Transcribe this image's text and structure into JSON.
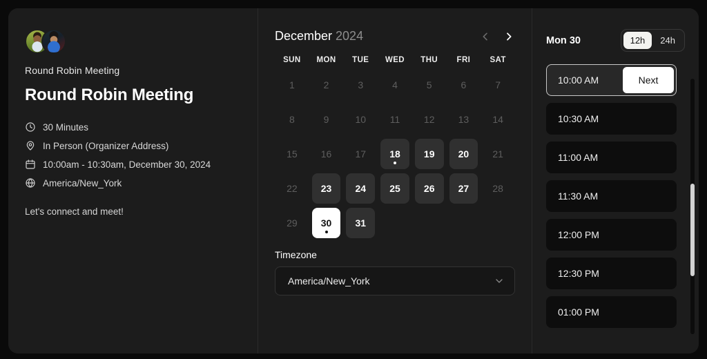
{
  "event": {
    "organizer_label": "Round Robin Meeting",
    "title": "Round Robin Meeting",
    "description": "Let's connect and meet!",
    "avatars": [
      {
        "name": "organizer-avatar-1"
      },
      {
        "name": "organizer-avatar-2"
      }
    ],
    "meta": [
      {
        "icon": "clock-icon",
        "text": "30 Minutes"
      },
      {
        "icon": "location-pin-icon",
        "text": "In Person (Organizer Address)"
      },
      {
        "icon": "calendar-icon",
        "text": "10:00am - 10:30am, December 30, 2024"
      },
      {
        "icon": "globe-icon",
        "text": "America/New_York"
      }
    ]
  },
  "calendar": {
    "month": "December",
    "year": "2024",
    "prev_label": "Previous month",
    "next_label": "Next month",
    "weekdays": [
      "SUN",
      "MON",
      "TUE",
      "WED",
      "THU",
      "FRI",
      "SAT"
    ],
    "leading_blanks": 0,
    "days": [
      {
        "n": "1",
        "state": "disabled"
      },
      {
        "n": "2",
        "state": "disabled"
      },
      {
        "n": "3",
        "state": "disabled"
      },
      {
        "n": "4",
        "state": "disabled"
      },
      {
        "n": "5",
        "state": "disabled"
      },
      {
        "n": "6",
        "state": "disabled"
      },
      {
        "n": "7",
        "state": "disabled"
      },
      {
        "n": "8",
        "state": "disabled"
      },
      {
        "n": "9",
        "state": "disabled"
      },
      {
        "n": "10",
        "state": "disabled"
      },
      {
        "n": "11",
        "state": "disabled"
      },
      {
        "n": "12",
        "state": "disabled"
      },
      {
        "n": "13",
        "state": "disabled"
      },
      {
        "n": "14",
        "state": "disabled"
      },
      {
        "n": "15",
        "state": "disabled"
      },
      {
        "n": "16",
        "state": "disabled"
      },
      {
        "n": "17",
        "state": "disabled"
      },
      {
        "n": "18",
        "state": "available",
        "dot": true
      },
      {
        "n": "19",
        "state": "available"
      },
      {
        "n": "20",
        "state": "available"
      },
      {
        "n": "21",
        "state": "disabled"
      },
      {
        "n": "22",
        "state": "disabled"
      },
      {
        "n": "23",
        "state": "available"
      },
      {
        "n": "24",
        "state": "available"
      },
      {
        "n": "25",
        "state": "available"
      },
      {
        "n": "26",
        "state": "available"
      },
      {
        "n": "27",
        "state": "available"
      },
      {
        "n": "28",
        "state": "disabled"
      },
      {
        "n": "29",
        "state": "disabled"
      },
      {
        "n": "30",
        "state": "selected",
        "dot": true
      },
      {
        "n": "31",
        "state": "available"
      }
    ],
    "timezone": {
      "label": "Timezone",
      "value": "America/New_York",
      "chevron": "chevron-down-icon"
    }
  },
  "slots": {
    "date_label": "Mon 30",
    "format_options": [
      {
        "label": "12h",
        "active": true
      },
      {
        "label": "24h",
        "active": false
      }
    ],
    "next_label": "Next",
    "times": [
      {
        "time": "10:00 AM",
        "selected": true
      },
      {
        "time": "10:30 AM",
        "selected": false
      },
      {
        "time": "11:00 AM",
        "selected": false
      },
      {
        "time": "11:30 AM",
        "selected": false
      },
      {
        "time": "12:00 PM",
        "selected": false
      },
      {
        "time": "12:30 PM",
        "selected": false
      },
      {
        "time": "01:00 PM",
        "selected": false
      }
    ]
  },
  "colors": {
    "page_bg": "#0a0a0a",
    "card_bg": "#1c1c1c",
    "slot_bg": "#0d0d0d",
    "available_day_bg": "#303030",
    "selected_bg": "#ffffff",
    "divider": "#2b2b2b",
    "muted_text": "#5e5e5e"
  }
}
